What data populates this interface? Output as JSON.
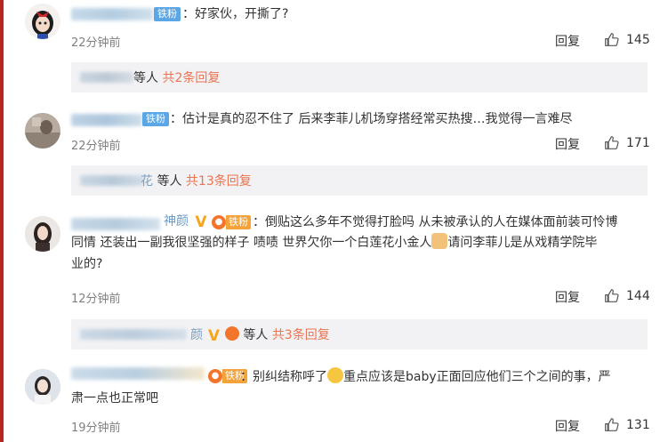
{
  "comments": [
    {
      "badge": "铁粉",
      "text": "好家伙，开撕了?",
      "time": "22分钟前",
      "reply": "回复",
      "likes": "145",
      "sub": {
        "suffix": "等人",
        "link": "共2条回复"
      }
    },
    {
      "badge": "铁粉",
      "text": "估计是真的忍不住了 后来李菲儿机场穿搭经常买热搜…我觉得一言难尽",
      "time": "22分钟前",
      "reply": "回复",
      "likes": "171",
      "sub": {
        "name_tail": "花",
        "suffix": "等人",
        "link": "共13条回复"
      }
    },
    {
      "name_tail": "神颜",
      "fan_label": "铁粉",
      "text_line1": "倒贴这么多年不觉得打脸吗 从未被承认的人在媒体面前装可怜博",
      "text_line2a": "同情 还装出一副我很坚强的样子 啧啧 世界欠你一个白莲花小金人",
      "text_line2b": "请问李菲儿是从戏精学院毕",
      "text_line3": "业的?",
      "time": "12分钟前",
      "reply": "回复",
      "likes": "144",
      "sub": {
        "name_tail": "颜",
        "suffix": "等人",
        "link": "共3条回复"
      }
    },
    {
      "fan_label": "铁粉",
      "text_line1a": "别纠结称呼了",
      "text_line1b": "重点应该是baby正面回应他们三个之间的事，严",
      "text_line2": "肃一点也正常吧",
      "time": "19分钟前",
      "reply": "回复",
      "likes": "131"
    }
  ],
  "colors": {
    "link": "#eb7350",
    "badge_blue": "#5ba7e6",
    "vip": "#f7a51b",
    "sub_bg": "#f2f2f5",
    "left_rule": "#b9261e"
  }
}
